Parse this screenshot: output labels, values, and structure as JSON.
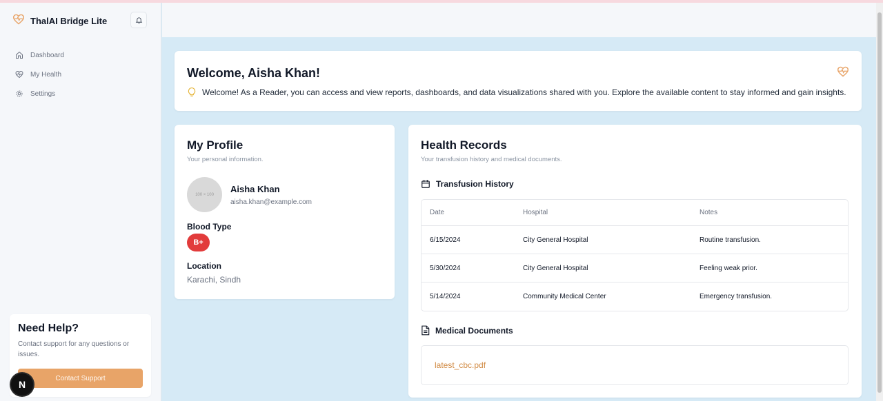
{
  "app": {
    "title": "ThalAI Bridge Lite"
  },
  "sidebar": {
    "items": [
      {
        "label": "Dashboard",
        "icon": "home-icon"
      },
      {
        "label": "My Health",
        "icon": "heart-pulse-icon"
      },
      {
        "label": "Settings",
        "icon": "gear-icon"
      }
    ],
    "help": {
      "title": "Need Help?",
      "text": "Contact support for any questions or issues.",
      "button": "Contact Support"
    },
    "badge": "N"
  },
  "welcome": {
    "title": "Welcome, Aisha Khan!",
    "message": "Welcome! As a Reader, you can access and view reports, dashboards, and data visualizations shared with you. Explore the available content to stay informed and gain insights."
  },
  "profile": {
    "title": "My Profile",
    "subtitle": "Your personal information.",
    "avatar_text": "100 × 100",
    "name": "Aisha Khan",
    "email": "aisha.khan@example.com",
    "blood_type_label": "Blood Type",
    "blood_type": "B+",
    "location_label": "Location",
    "location": "Karachi, Sindh"
  },
  "records": {
    "title": "Health Records",
    "subtitle": "Your transfusion history and medical documents.",
    "transfusion_title": "Transfusion History",
    "columns": [
      "Date",
      "Hospital",
      "Notes"
    ],
    "rows": [
      [
        "6/15/2024",
        "City General Hospital",
        "Routine transfusion."
      ],
      [
        "5/30/2024",
        "City General Hospital",
        "Feeling weak prior."
      ],
      [
        "5/14/2024",
        "Community Medical Center",
        "Emergency transfusion."
      ]
    ],
    "documents_title": "Medical Documents",
    "documents": [
      "latest_cbc.pdf"
    ]
  },
  "colors": {
    "accent": "#e8a468",
    "blood": "#e23b3b",
    "background": "#d6eaf6"
  }
}
